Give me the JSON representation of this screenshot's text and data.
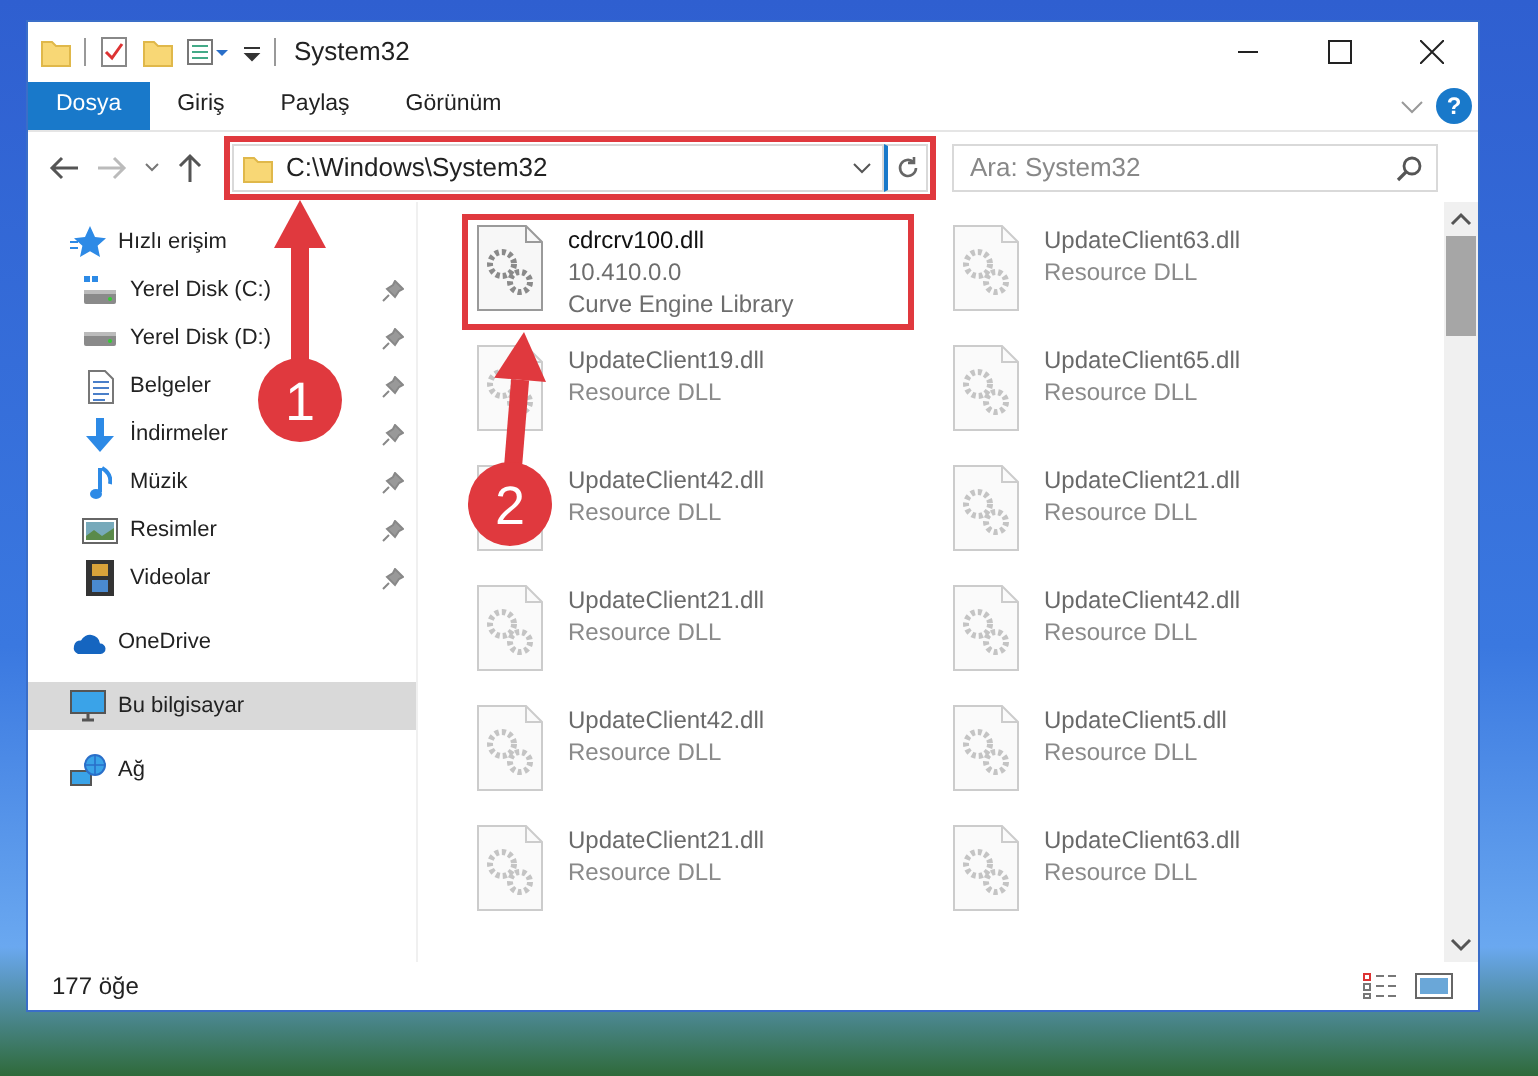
{
  "window": {
    "title": "System32"
  },
  "ribbon_tabs": [
    {
      "label": "Dosya",
      "selected": true
    },
    {
      "label": "Giriş",
      "selected": false
    },
    {
      "label": "Paylaş",
      "selected": false
    },
    {
      "label": "Görünüm",
      "selected": false
    }
  ],
  "help_button": {
    "label": "?"
  },
  "address": {
    "path": "C:\\Windows\\System32",
    "highlighted": true
  },
  "search": {
    "placeholder": "Ara: System32"
  },
  "navigation": [
    {
      "label": "Hızlı erişim",
      "kind": "star",
      "selected": false,
      "children": [
        {
          "label": "Yerel Disk (C:)",
          "kind": "system-drive",
          "pinned": true,
          "selected": false
        },
        {
          "label": "Yerel Disk (D:)",
          "kind": "drive",
          "pinned": true,
          "selected": false
        },
        {
          "label": "Belgeler",
          "kind": "document",
          "pinned": true,
          "selected": false
        },
        {
          "label": "İndirmeler",
          "kind": "download",
          "pinned": true,
          "selected": false
        },
        {
          "label": "Müzik",
          "kind": "music",
          "pinned": true,
          "selected": false
        },
        {
          "label": "Resimler",
          "kind": "picture",
          "pinned": true,
          "selected": false
        },
        {
          "label": "Videolar",
          "kind": "video",
          "pinned": true,
          "selected": false
        }
      ]
    },
    {
      "label": "OneDrive",
      "kind": "cloud",
      "selected": false
    },
    {
      "label": "Bu bilgisayar",
      "kind": "computer",
      "selected": true
    },
    {
      "label": "Ağ",
      "kind": "network",
      "selected": false
    }
  ],
  "files": [
    {
      "name": "cdrcrv100.dll",
      "version": "10.410.0.0",
      "description": "Curve Engine Library",
      "highlighted": true
    },
    {
      "name": "UpdateClient63.dll",
      "description": "Resource DLL",
      "highlighted": false
    },
    {
      "name": "UpdateClient19.dll",
      "description": "Resource DLL",
      "highlighted": false
    },
    {
      "name": "UpdateClient65.dll",
      "description": "Resource DLL",
      "highlighted": false
    },
    {
      "name": "UpdateClient42.dll",
      "description": "Resource DLL",
      "highlighted": false
    },
    {
      "name": "UpdateClient21.dll",
      "description": "Resource DLL",
      "highlighted": false
    },
    {
      "name": "UpdateClient21.dll",
      "description": "Resource DLL",
      "highlighted": false
    },
    {
      "name": "UpdateClient42.dll",
      "description": "Resource DLL",
      "highlighted": false
    },
    {
      "name": "UpdateClient42.dll",
      "description": "Resource DLL",
      "highlighted": false
    },
    {
      "name": "UpdateClient5.dll",
      "description": "Resource DLL",
      "highlighted": false
    },
    {
      "name": "UpdateClient21.dll",
      "description": "Resource DLL",
      "highlighted": false
    },
    {
      "name": "UpdateClient63.dll",
      "description": "Resource DLL",
      "highlighted": false
    }
  ],
  "status_bar": {
    "item_count": "177 öğe"
  },
  "annotations": [
    {
      "label": "1",
      "kind": "address"
    },
    {
      "label": "2",
      "kind": "file"
    }
  ]
}
